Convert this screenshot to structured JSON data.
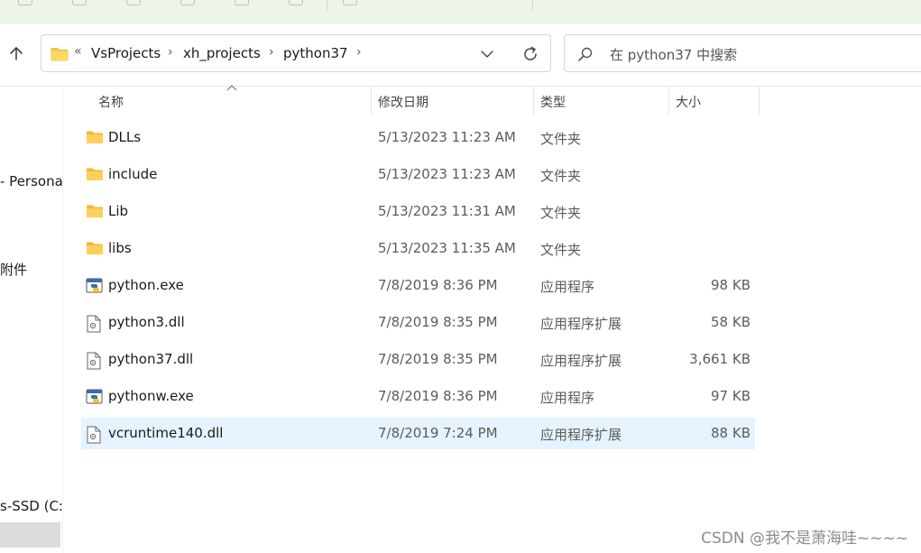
{
  "ribbon": {
    "accent": "#ecf5e8"
  },
  "address_bar": {
    "overflow_chevron": "«",
    "crumbs": [
      "VsProjects",
      "xh_projects",
      "python37"
    ],
    "separator": "›"
  },
  "search": {
    "placeholder": "在 python37 中搜索"
  },
  "nav": {
    "items": [
      "- Persona",
      "附件",
      "s-SSD (C:)"
    ]
  },
  "columns": {
    "name": "名称",
    "modified": "修改日期",
    "type": "类型",
    "size": "大小"
  },
  "files": [
    {
      "name": "DLLs",
      "modified": "5/13/2023 11:23 AM",
      "type": "文件夹",
      "size": "",
      "icon": "folder-icon"
    },
    {
      "name": "include",
      "modified": "5/13/2023 11:23 AM",
      "type": "文件夹",
      "size": "",
      "icon": "folder-icon"
    },
    {
      "name": "Lib",
      "modified": "5/13/2023 11:31 AM",
      "type": "文件夹",
      "size": "",
      "icon": "folder-icon"
    },
    {
      "name": "libs",
      "modified": "5/13/2023 11:35 AM",
      "type": "文件夹",
      "size": "",
      "icon": "folder-icon"
    },
    {
      "name": "python.exe",
      "modified": "7/8/2019 8:36 PM",
      "type": "应用程序",
      "size": "98 KB",
      "icon": "python-exe-icon"
    },
    {
      "name": "python3.dll",
      "modified": "7/8/2019 8:35 PM",
      "type": "应用程序扩展",
      "size": "58 KB",
      "icon": "dll-icon"
    },
    {
      "name": "python37.dll",
      "modified": "7/8/2019 8:35 PM",
      "type": "应用程序扩展",
      "size": "3,661 KB",
      "icon": "dll-icon"
    },
    {
      "name": "pythonw.exe",
      "modified": "7/8/2019 8:36 PM",
      "type": "应用程序",
      "size": "97 KB",
      "icon": "python-exe-icon"
    },
    {
      "name": "vcruntime140.dll",
      "modified": "7/8/2019 7:24 PM",
      "type": "应用程序扩展",
      "size": "88 KB",
      "icon": "dll-icon",
      "selected": true
    }
  ],
  "watermark": "CSDN @我不是萧海哇~~~~",
  "colors": {
    "selection": "#e5f3fe",
    "folder": "#f8c94a"
  }
}
